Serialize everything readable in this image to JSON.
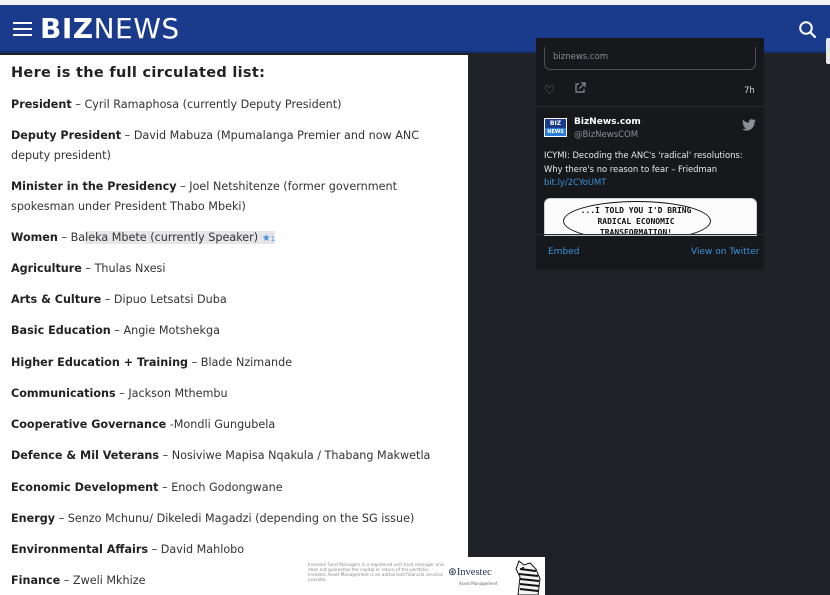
{
  "header": {
    "logo_bold": "BIZ",
    "logo_regular": "NEWS",
    "menu_icon": "hamburger-menu-icon",
    "search_icon": "search-icon",
    "bar_color": "#1a3a8c"
  },
  "article": {
    "heading": "Here is the full circulated list:",
    "highlight_count": "1",
    "entries": [
      {
        "role": "President",
        "sep": " – ",
        "detail": "Cyril Ramaphosa (currently Deputy President)"
      },
      {
        "role": "Deputy President",
        "sep": " – ",
        "detail": "David Mabuza (Mpumalanga Premier and now ANC deputy president)"
      },
      {
        "role": "Minister in the Presidency",
        "sep": " – ",
        "detail": "Joel Netshitenze (former government spokesman under President Thabo Mbeki)"
      },
      {
        "role": "Women",
        "sep": " – ",
        "detail_a": "Ba",
        "detail_b": "leka Mbete (currently Speaker)"
      },
      {
        "role": "Agriculture",
        "sep": " – ",
        "detail": "Thulas Nxesi"
      },
      {
        "role": "Arts & Culture",
        "sep": " – ",
        "detail": "Dipuo Letsatsi Duba"
      },
      {
        "role": "Basic Education",
        "sep": " – ",
        "detail": "Angie Motshekga"
      },
      {
        "role": "Higher Education + Training",
        "sep": " – ",
        "detail": "Blade Nzimande"
      },
      {
        "role": "Communications",
        "sep": " – ",
        "detail": "Jackson Mthembu"
      },
      {
        "role": "Cooperative Governance",
        "sep": " -",
        "detail": "Mondli Gungubela"
      },
      {
        "role": "Defence & Mil Veterans",
        "sep": " – ",
        "detail": "Nosiviwe Mapisa Nqakula / Thabang Makwetla"
      },
      {
        "role": "Economic Development",
        "sep": " – ",
        "detail": "Enoch Godongwane"
      },
      {
        "role": "Energy",
        "sep": " – ",
        "detail": "Senzo Mchunu/ Dikeledi Magadzi (depending on the SG issue)"
      },
      {
        "role": "Environmental Affairs",
        "sep": " – ",
        "detail": "David Mahlobo"
      },
      {
        "role": "Finance",
        "sep": " – ",
        "detail": "Zweli Mkhize"
      }
    ]
  },
  "twitter": {
    "prev_link": "biznews.com",
    "prev_time": "7h",
    "avatar_top": "BIZ",
    "avatar_bottom": "NEWS",
    "display_name": "BizNews.com",
    "handle": "@BizNewsCOM",
    "tweet_text": "ICYMI: Decoding the ANC's 'radical' resolutions: Why there's no reason to fear – Friedman",
    "tweet_link": "bit.ly/2CYoUMT",
    "cartoon_text_1": "...I TOLD YOU I'D BRING",
    "cartoon_text_2": "RADICAL ECONOMIC",
    "cartoon_text_3": "TRANSFORMATION!",
    "embed_label": "Embed",
    "view_label": "View on Twitter",
    "link_color": "#3b94d9"
  },
  "ad": {
    "disclaimer": "Investec Fund Managers is a registered unit trust manager and does not guarantee the capital or return of the portfolio. Investec Asset Management is an authorised financial services provider.",
    "brand": "Investec",
    "sub": "Asset Management"
  }
}
